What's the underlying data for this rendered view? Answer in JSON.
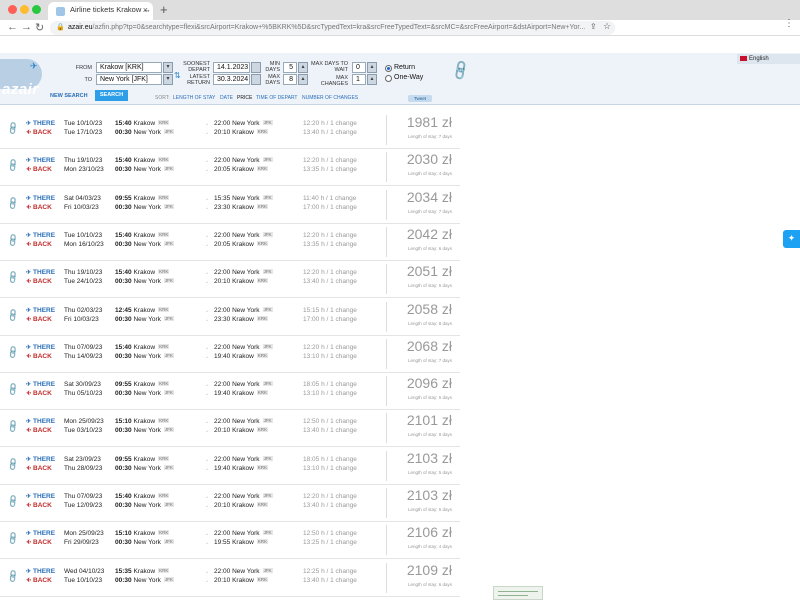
{
  "browser": {
    "tab_title": "Airline tickets Krakow ↔ New Y",
    "url_host": "azair.eu",
    "url_path": "/azfin.php?tp=0&searchtype=flexi&srcAirport=Krakow+%5BKRK%5D&srcTypedText=kra&srcFreeTypedText=&srcMC=&srcFreeAirport=&dstAirport=New+Yor..."
  },
  "logo": "azair",
  "language": "English",
  "search": {
    "from_label": "FROM",
    "from_value": "Krakow [KRK]",
    "to_label": "TO",
    "to_value": "New York [JFK]",
    "soonest_label": "SOONEST DEPART",
    "soonest_value": "14.1.2023",
    "latest_label": "LATEST RETURN",
    "latest_value": "30.3.2024",
    "min_days_label": "MIN DAYS",
    "min_days_value": "5",
    "max_days_label": "MAX DAYS",
    "max_days_value": "8",
    "max_wait_label": "MAX DAYS TO WAIT",
    "max_wait_value": "0",
    "max_changes_label": "MAX CHANGES",
    "max_changes_value": "1",
    "radio_return": "Return",
    "radio_oneway": "One-Way",
    "new_search": "NEW SEARCH",
    "search_button": "SEARCH",
    "sort_label": "SORT:",
    "sort_options": [
      "LENGTH OF STAY",
      "DATE",
      "PRICE",
      "TIME OF DEPART",
      "NUMBER OF CHANGES"
    ],
    "tweet": "Tweet"
  },
  "labels": {
    "there": "THERE",
    "back": "BACK"
  },
  "results": [
    {
      "out_date": "Tue 10/10/23",
      "out_time": "15:40",
      "out_from": "Krakow",
      "out_from_code": "KRK",
      "out_arr": "22:00",
      "out_to": "New York",
      "out_to_code": "JFK",
      "out_dur": "12:20 h / 1 change",
      "ret_date": "Tue 17/10/23",
      "ret_time": "00:30",
      "ret_from": "New York",
      "ret_from_code": "JFK",
      "ret_arr": "20:10",
      "ret_to": "Krakow",
      "ret_to_code": "KRK",
      "ret_dur": "13:40 h / 1 change",
      "price": "1981 zł",
      "stay": "Length of stay: 7 days"
    },
    {
      "out_date": "Thu 19/10/23",
      "out_time": "15:40",
      "out_from": "Krakow",
      "out_from_code": "KRK",
      "out_arr": "22:00",
      "out_to": "New York",
      "out_to_code": "JFK",
      "out_dur": "12:20 h / 1 change",
      "ret_date": "Mon 23/10/23",
      "ret_time": "00:30",
      "ret_from": "New York",
      "ret_from_code": "JFK",
      "ret_arr": "20:05",
      "ret_to": "Krakow",
      "ret_to_code": "KRK",
      "ret_dur": "13:35 h / 1 change",
      "price": "2030 zł",
      "stay": "Length of stay: 4 days"
    },
    {
      "out_date": "Sat 04/03/23",
      "out_time": "09:55",
      "out_from": "Krakow",
      "out_from_code": "KRK",
      "out_arr": "15:35",
      "out_to": "New York",
      "out_to_code": "JFK",
      "out_dur": "11:40 h / 1 change",
      "ret_date": "Fri 10/03/23",
      "ret_time": "00:30",
      "ret_from": "New York",
      "ret_from_code": "JFK",
      "ret_arr": "23:30",
      "ret_to": "Krakow",
      "ret_to_code": "KRK",
      "ret_dur": "17:00 h / 1 change",
      "price": "2034 zł",
      "stay": "Length of stay: 7 days"
    },
    {
      "out_date": "Tue 10/10/23",
      "out_time": "15:40",
      "out_from": "Krakow",
      "out_from_code": "KRK",
      "out_arr": "22:00",
      "out_to": "New York",
      "out_to_code": "JFK",
      "out_dur": "12:20 h / 1 change",
      "ret_date": "Mon 16/10/23",
      "ret_time": "00:30",
      "ret_from": "New York",
      "ret_from_code": "JFK",
      "ret_arr": "20:05",
      "ret_to": "Krakow",
      "ret_to_code": "KRK",
      "ret_dur": "13:35 h / 1 change",
      "price": "2042 zł",
      "stay": "Length of stay: 6 days"
    },
    {
      "out_date": "Thu 19/10/23",
      "out_time": "15:40",
      "out_from": "Krakow",
      "out_from_code": "KRK",
      "out_arr": "22:00",
      "out_to": "New York",
      "out_to_code": "JFK",
      "out_dur": "12:20 h / 1 change",
      "ret_date": "Tue 24/10/23",
      "ret_time": "00:30",
      "ret_from": "New York",
      "ret_from_code": "JFK",
      "ret_arr": "20:10",
      "ret_to": "Krakow",
      "ret_to_code": "KRK",
      "ret_dur": "13:40 h / 1 change",
      "price": "2051 zł",
      "stay": "Length of stay: 5 days"
    },
    {
      "out_date": "Thu 02/03/23",
      "out_time": "12:45",
      "out_from": "Krakow",
      "out_from_code": "KRK",
      "out_arr": "22:00",
      "out_to": "New York",
      "out_to_code": "JFK",
      "out_dur": "15:15 h / 1 change",
      "ret_date": "Fri 10/03/23",
      "ret_time": "00:30",
      "ret_from": "New York",
      "ret_from_code": "JFK",
      "ret_arr": "23:30",
      "ret_to": "Krakow",
      "ret_to_code": "KRK",
      "ret_dur": "17:00 h / 1 change",
      "price": "2058 zł",
      "stay": "Length of stay: 8 days"
    },
    {
      "out_date": "Thu 07/09/23",
      "out_time": "15:40",
      "out_from": "Krakow",
      "out_from_code": "KRK",
      "out_arr": "22:00",
      "out_to": "New York",
      "out_to_code": "JFK",
      "out_dur": "12:20 h / 1 change",
      "ret_date": "Thu 14/09/23",
      "ret_time": "00:30",
      "ret_from": "New York",
      "ret_from_code": "JFK",
      "ret_arr": "19:40",
      "ret_to": "Krakow",
      "ret_to_code": "KRK",
      "ret_dur": "13:10 h / 1 change",
      "price": "2068 zł",
      "stay": "Length of stay: 7 days"
    },
    {
      "out_date": "Sat 30/09/23",
      "out_time": "09:55",
      "out_from": "Krakow",
      "out_from_code": "KRK",
      "out_arr": "22:00",
      "out_to": "New York",
      "out_to_code": "JFK",
      "out_dur": "18:05 h / 1 change",
      "ret_date": "Thu 05/10/23",
      "ret_time": "00:30",
      "ret_from": "New York",
      "ret_from_code": "JFK",
      "ret_arr": "19:40",
      "ret_to": "Krakow",
      "ret_to_code": "KRK",
      "ret_dur": "13:10 h / 1 change",
      "price": "2096 zł",
      "stay": "Length of stay: 5 days"
    },
    {
      "out_date": "Mon 25/09/23",
      "out_time": "15:10",
      "out_from": "Krakow",
      "out_from_code": "KRK",
      "out_arr": "22:00",
      "out_to": "New York",
      "out_to_code": "JFK",
      "out_dur": "12:50 h / 1 change",
      "ret_date": "Tue 03/10/23",
      "ret_time": "00:30",
      "ret_from": "New York",
      "ret_from_code": "JFK",
      "ret_arr": "20:10",
      "ret_to": "Krakow",
      "ret_to_code": "KRK",
      "ret_dur": "13:40 h / 1 change",
      "price": "2101 zł",
      "stay": "Length of stay: 8 days"
    },
    {
      "out_date": "Sat 23/09/23",
      "out_time": "09:55",
      "out_from": "Krakow",
      "out_from_code": "KRK",
      "out_arr": "22:00",
      "out_to": "New York",
      "out_to_code": "JFK",
      "out_dur": "18:05 h / 1 change",
      "ret_date": "Thu 28/09/23",
      "ret_time": "00:30",
      "ret_from": "New York",
      "ret_from_code": "JFK",
      "ret_arr": "19:40",
      "ret_to": "Krakow",
      "ret_to_code": "KRK",
      "ret_dur": "13:10 h / 1 change",
      "price": "2103 zł",
      "stay": "Length of stay: 5 days"
    },
    {
      "out_date": "Thu 07/09/23",
      "out_time": "15:40",
      "out_from": "Krakow",
      "out_from_code": "KRK",
      "out_arr": "22:00",
      "out_to": "New York",
      "out_to_code": "JFK",
      "out_dur": "12:20 h / 1 change",
      "ret_date": "Tue 12/09/23",
      "ret_time": "00:30",
      "ret_from": "New York",
      "ret_from_code": "JFK",
      "ret_arr": "20:10",
      "ret_to": "Krakow",
      "ret_to_code": "KRK",
      "ret_dur": "13:40 h / 1 change",
      "price": "2103 zł",
      "stay": "Length of stay: 5 days"
    },
    {
      "out_date": "Mon 25/09/23",
      "out_time": "15:10",
      "out_from": "Krakow",
      "out_from_code": "KRK",
      "out_arr": "22:00",
      "out_to": "New York",
      "out_to_code": "JFK",
      "out_dur": "12:50 h / 1 change",
      "ret_date": "Fri 29/09/23",
      "ret_time": "00:30",
      "ret_from": "New York",
      "ret_from_code": "JFK",
      "ret_arr": "19:55",
      "ret_to": "Krakow",
      "ret_to_code": "KRK",
      "ret_dur": "13:25 h / 1 change",
      "price": "2106 zł",
      "stay": "Length of stay: 4 days"
    },
    {
      "out_date": "Wed 04/10/23",
      "out_time": "15:35",
      "out_from": "Krakow",
      "out_from_code": "KRK",
      "out_arr": "22:00",
      "out_to": "New York",
      "out_to_code": "JFK",
      "out_dur": "12:25 h / 1 change",
      "ret_date": "Tue 10/10/23",
      "ret_time": "00:30",
      "ret_from": "New York",
      "ret_from_code": "JFK",
      "ret_arr": "20:10",
      "ret_to": "Krakow",
      "ret_to_code": "KRK",
      "ret_dur": "13:40 h / 1 change",
      "price": "2109 zł",
      "stay": "Length of stay: 6 days"
    }
  ],
  "colors": {
    "there": "#2b6fb8",
    "back": "#c52b2b",
    "search_button": "#2f9ee8",
    "header_bg": "#eef3f9"
  }
}
